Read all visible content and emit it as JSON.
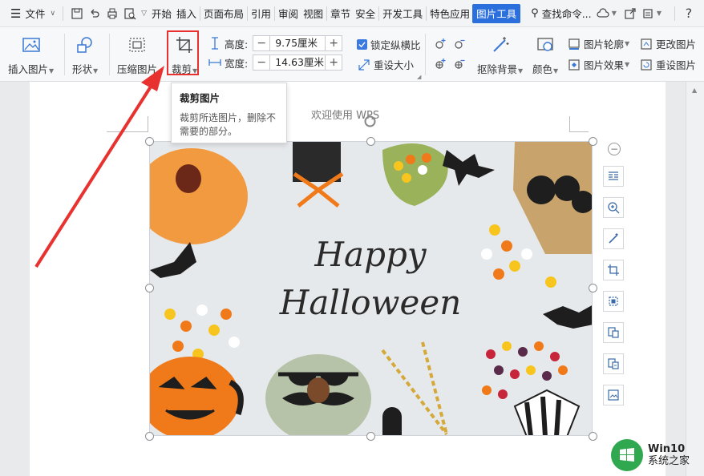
{
  "menubar": {
    "file_label": "文件",
    "tabs": [
      "开始",
      "插入",
      "页面布局",
      "引用",
      "审阅",
      "视图",
      "章节",
      "安全",
      "开发工具",
      "特色应用",
      "图片工具"
    ],
    "active_tab": "图片工具",
    "search_label": "查找命令..."
  },
  "ribbon": {
    "insert_image": "插入图片",
    "shape": "形状",
    "compress": "压缩图片",
    "crop": "裁剪",
    "height_label": "高度:",
    "height_value": "9.75厘米",
    "width_label": "宽度:",
    "width_value": "14.63厘米",
    "lock_ratio": "锁定纵横比",
    "reset_size": "重设大小",
    "remove_bg": "抠除背景",
    "color": "颜色",
    "image_outline": "图片轮廓",
    "image_effect": "图片效果",
    "change_image": "更改图片",
    "reset_image": "重设图片"
  },
  "tooltip": {
    "title": "裁剪图片",
    "body": "裁剪所选图片，删除不需要的部分。"
  },
  "document": {
    "header_text": "欢迎使用 WPS",
    "image_text_line1": "Happy",
    "image_text_line2": "Halloween"
  },
  "watermark": {
    "line1": "Win10",
    "line2": "系统之家"
  },
  "colors": {
    "accent": "#2a6fdb",
    "highlight_red": "#e8312e",
    "arrow_red": "#e8322f"
  }
}
